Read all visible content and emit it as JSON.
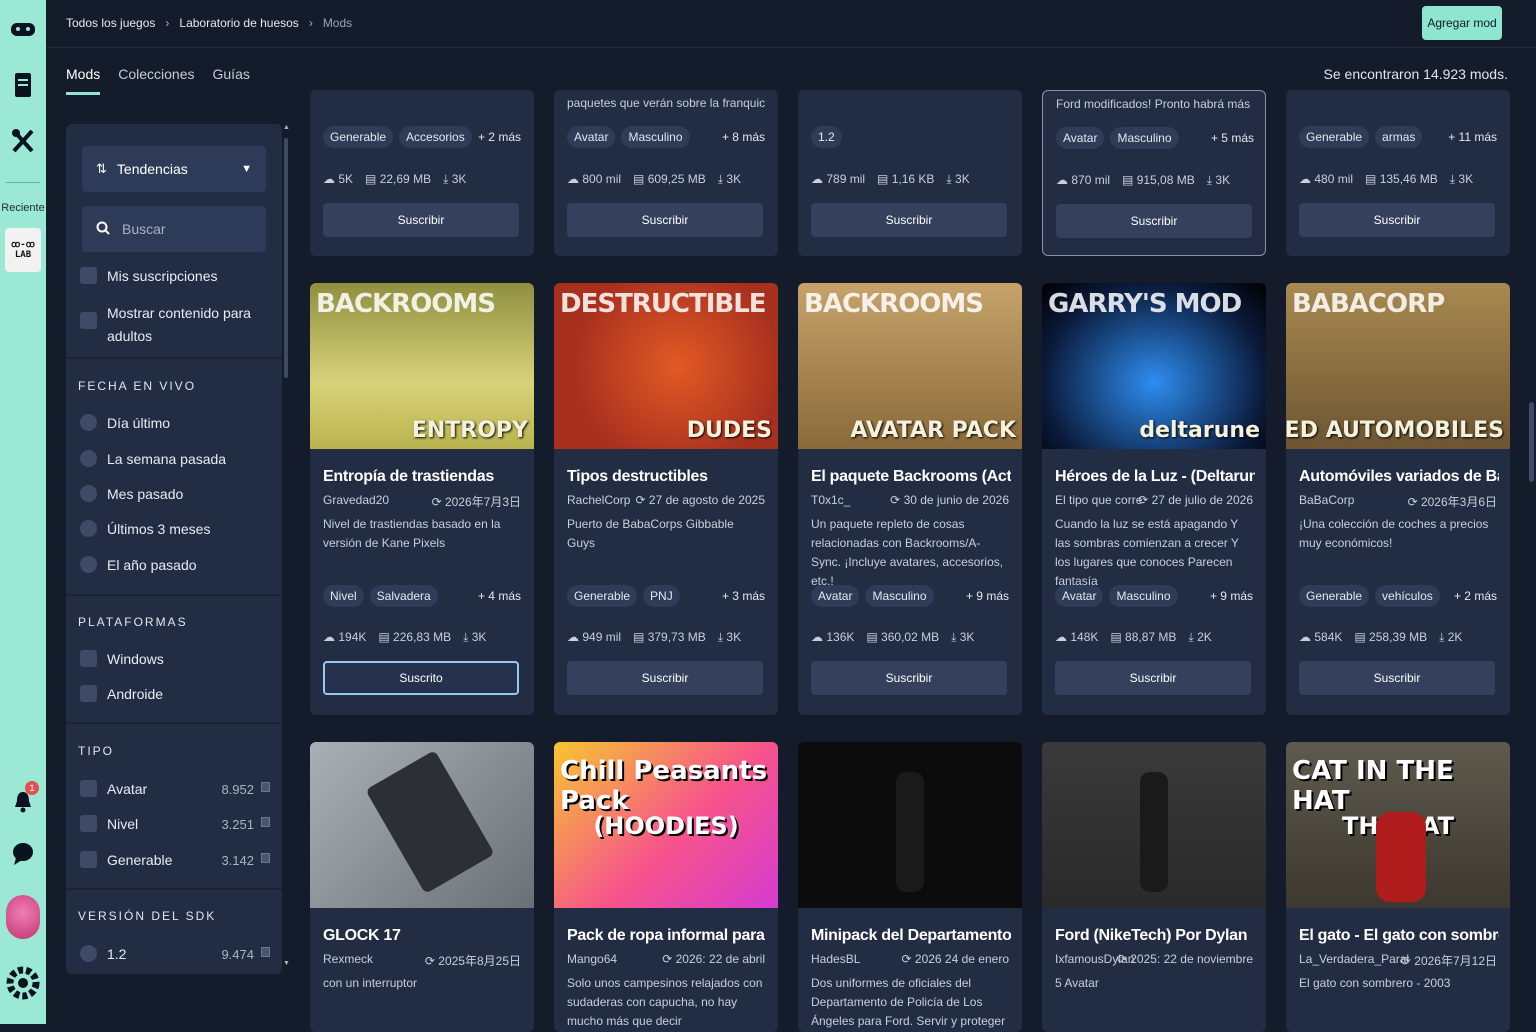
{
  "rail": {
    "recent_label": "Reciente",
    "lab_top": "ꝏ‑ꝏ",
    "lab_bottom": "LAB",
    "notifications": "1"
  },
  "breadcrumb": [
    "Todos los juegos",
    "Laboratorio de huesos",
    "Mods"
  ],
  "add_mod_label": "Agregar mod",
  "tabs": [
    "Mods",
    "Colecciones",
    "Guías"
  ],
  "results_text": "Se encontraron 14.923 mods.",
  "sidebar": {
    "sort_label": "Tendencias",
    "search_placeholder": "Buscar",
    "checks": [
      "Mis suscripciones",
      "Mostrar contenido para",
      "adultos"
    ],
    "date_header": "FECHA EN VIVO",
    "date_options": [
      "Día último",
      "La semana pasada",
      "Mes pasado",
      "Últimos 3 meses",
      "El año pasado"
    ],
    "platform_header": "PLATAFORMAS",
    "platforms": [
      "Windows",
      "Androide"
    ],
    "type_header": "TIPO",
    "types": [
      {
        "label": "Avatar",
        "count": "8.952"
      },
      {
        "label": "Nivel",
        "count": "3.251"
      },
      {
        "label": "Generable",
        "count": "3.142"
      }
    ],
    "sdk_header": "VERSIÓN DEL SDK",
    "sdk": [
      {
        "label": "1.2",
        "count": "9.474"
      }
    ]
  },
  "row1": [
    {
      "desc": "",
      "tags": [
        "Generable",
        "Accesorios"
      ],
      "more": "+ 2 más",
      "stats": [
        "5K",
        "22,69 MB",
        "3K"
      ],
      "btn": "Suscribir"
    },
    {
      "desc": "paquetes que verán sobre la franquicia. Pa...",
      "tags": [
        "Avatar",
        "Masculino"
      ],
      "more": "+ 8 más",
      "stats": [
        "800 mil",
        "609,25 MB",
        "3K"
      ],
      "btn": "Suscribir"
    },
    {
      "desc": "",
      "tags": [
        "1.2"
      ],
      "more": "",
      "stats": [
        "789 mil",
        "1,16 KB",
        "3K"
      ],
      "btn": "Suscribir"
    },
    {
      "desc": "Ford modificados! Pronto habrá más :D",
      "tags": [
        "Avatar",
        "Masculino"
      ],
      "more": "+ 5 más",
      "stats": [
        "870 mil",
        "915,08 MB",
        "3K"
      ],
      "btn": "Suscribir"
    },
    {
      "desc": "",
      "tags": [
        "Generable",
        "armas"
      ],
      "more": "+ 11 más",
      "stats": [
        "480 mil",
        "135,46 MB",
        "3K"
      ],
      "btn": "Suscribir"
    }
  ],
  "row2": [
    {
      "img_text": [
        "BACKROOMS",
        "ENTROPY"
      ],
      "title": "Entropía de trastiendas",
      "author": "Gravedad20",
      "date": "2026年7月3日",
      "desc": "Nivel de trastiendas basado en la versión de Kane Pixels",
      "tags": [
        "Nivel",
        "Salvadera"
      ],
      "more": "+ 4 más",
      "stats": [
        "194K",
        "226,83 MB",
        "3K"
      ],
      "btn": "Suscrito"
    },
    {
      "img_text": [
        "DESTRUCTIBLE",
        "DUDES"
      ],
      "title": "Tipos destructibles",
      "author": "RachelCorp",
      "date": "27 de agosto de 2025",
      "desc": "Puerto de BabaCorps Gibbable Guys",
      "tags": [
        "Generable",
        "PNJ"
      ],
      "more": "+ 3 más",
      "stats": [
        "949 mil",
        "379,73 MB",
        "3K"
      ],
      "btn": "Suscribir"
    },
    {
      "img_text": [
        "BACKROOMS",
        "AVATAR PACK"
      ],
      "title": "El paquete Backrooms (Actu...",
      "author": "T0x1c_",
      "date": "30 de junio de 2026",
      "desc": "Un paquete repleto de cosas relacionadas con Backrooms/A-Sync. ¡Incluye avatares, accesorios, etc.!",
      "tags": [
        "Avatar",
        "Masculino"
      ],
      "more": "+ 9 más",
      "stats": [
        "136K",
        "360,02 MB",
        "3K"
      ],
      "btn": "Suscribir"
    },
    {
      "img_text": [
        "GARRY'S MOD",
        "deltarune"
      ],
      "title": "Héroes de la Luz - (Deltarune...",
      "author": "El tipo que corre",
      "date": "27 de julio de 2026",
      "desc": "Cuando la luz se está apagando Y las sombras comienzan a crecer Y los lugares que conoces Parecen fantasía",
      "tags": [
        "Avatar",
        "Masculino"
      ],
      "more": "+ 9 más",
      "stats": [
        "148K",
        "88,87 MB",
        "2K"
      ],
      "btn": "Suscribir"
    },
    {
      "img_text": [
        "BABACORP",
        "ASSORTED AUTOMOBILES"
      ],
      "title": "Automóviles variados de Ba...",
      "author": "BaBaCorp",
      "date": "2026年3月6日",
      "desc": "¡Una colección de coches a precios muy económicos!",
      "tags": [
        "Generable",
        "vehículos"
      ],
      "more": "+ 2 más",
      "stats": [
        "584K",
        "258,39 MB",
        "2K"
      ],
      "btn": "Suscribir"
    }
  ],
  "row3": [
    {
      "img_text": [],
      "title": "GLOCK 17",
      "author": "Rexmeck",
      "date": "2025年8月25日",
      "desc": "con un interruptor"
    },
    {
      "img_text": [
        "Chill Peasants Pack",
        "(HOODIES)"
      ],
      "title": "Pack de ropa informal para c...",
      "author": "Mango64",
      "date": "2026: 22 de abril",
      "desc": "Solo unos campesinos relajados con sudaderas con capucha, no hay mucho más que decir"
    },
    {
      "img_text": [],
      "title": "Minipack del Departamento ...",
      "author": "HadesBL",
      "date": "2026 24 de enero",
      "desc": "Dos uniformes de oficiales del Departamento de Policía de Los Ángeles para Ford. Servir y proteger"
    },
    {
      "img_text": [],
      "title": "Ford (NikeTech) Por Dylan",
      "author": "IxfamousDylan",
      "date": "2025: 22 de noviembre",
      "desc": "5 Avatar"
    },
    {
      "img_text": [
        "CAT IN THE HAT",
        "THE CAT"
      ],
      "title": "El gato - El gato con sombrero",
      "author": "La_Verdadera_Parabollaa",
      "date": "2026年7月12日",
      "desc": "El gato con sombrero - 2003"
    }
  ]
}
